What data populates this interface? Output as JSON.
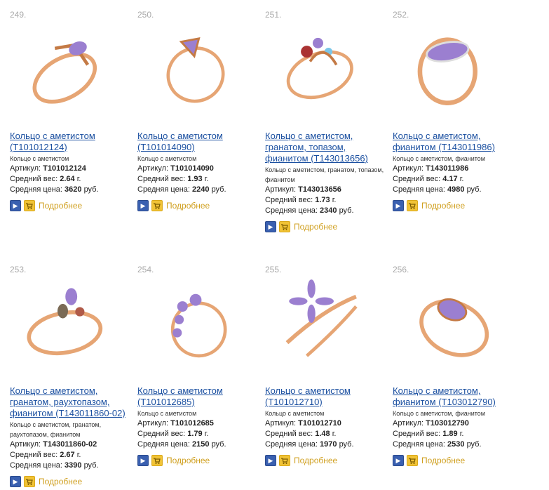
{
  "labels": {
    "article": "Артикул:",
    "weight": "Средний вес:",
    "price": "Средняя цена:",
    "more": "Подробнее"
  },
  "products": [
    {
      "num": "249.",
      "title": "Кольцо с аметистом (T101012124)",
      "desc": "Кольцо с аметистом",
      "article": "T101012124",
      "weight": "2.64",
      "weight_unit": "г.",
      "price": "3620",
      "price_unit": "руб."
    },
    {
      "num": "250.",
      "title": "Кольцо с аметистом (T101014090)",
      "desc": "Кольцо с аметистом",
      "article": "T101014090",
      "weight": "1.93",
      "weight_unit": "г.",
      "price": "2240",
      "price_unit": "руб."
    },
    {
      "num": "251.",
      "title": "Кольцо с аметистом, гранатом, топазом, фианитом (T143013656)",
      "desc": "Кольцо с аметистом, гранатом, топазом, фианитом",
      "article": "T143013656",
      "weight": "1.73",
      "weight_unit": "г.",
      "price": "2340",
      "price_unit": "руб."
    },
    {
      "num": "252.",
      "title": "Кольцо с аметистом, фианитом (T143011986)",
      "desc": "Кольцо с аметистом, фианитом",
      "article": "T143011986",
      "weight": "4.17",
      "weight_unit": "г.",
      "price": "4980",
      "price_unit": "руб."
    },
    {
      "num": "253.",
      "title": "Кольцо с аметистом, гранатом, раухтопазом, фианитом (T143011860-02)",
      "desc": "Кольцо с аметистом, гранатом, раухтопазом, фианитом",
      "article": "T143011860-02",
      "weight": "2.67",
      "weight_unit": "г.",
      "price": "3390",
      "price_unit": "руб."
    },
    {
      "num": "254.",
      "title": "Кольцо с аметистом (T101012685)",
      "desc": "Кольцо с аметистом",
      "article": "T101012685",
      "weight": "1.79",
      "weight_unit": "г.",
      "price": "2150",
      "price_unit": "руб."
    },
    {
      "num": "255.",
      "title": "Кольцо с аметистом (T101012710)",
      "desc": "Кольцо с аметистом",
      "article": "T101012710",
      "weight": "1.48",
      "weight_unit": "г.",
      "price": "1970",
      "price_unit": "руб."
    },
    {
      "num": "256.",
      "title": "Кольцо с аметистом, фианитом (T103012790)",
      "desc": "Кольцо с аметистом, фианитом",
      "article": "T103012790",
      "weight": "1.89",
      "weight_unit": "г.",
      "price": "2530",
      "price_unit": "руб."
    }
  ],
  "colors": {
    "gold": "#e6a574",
    "gold_dark": "#c47a45",
    "amethyst": "#9b7fd0",
    "link": "#1a4fa0",
    "more": "#d0a020"
  },
  "icons": {
    "go": "arrow-right-icon",
    "cart": "cart-icon"
  }
}
